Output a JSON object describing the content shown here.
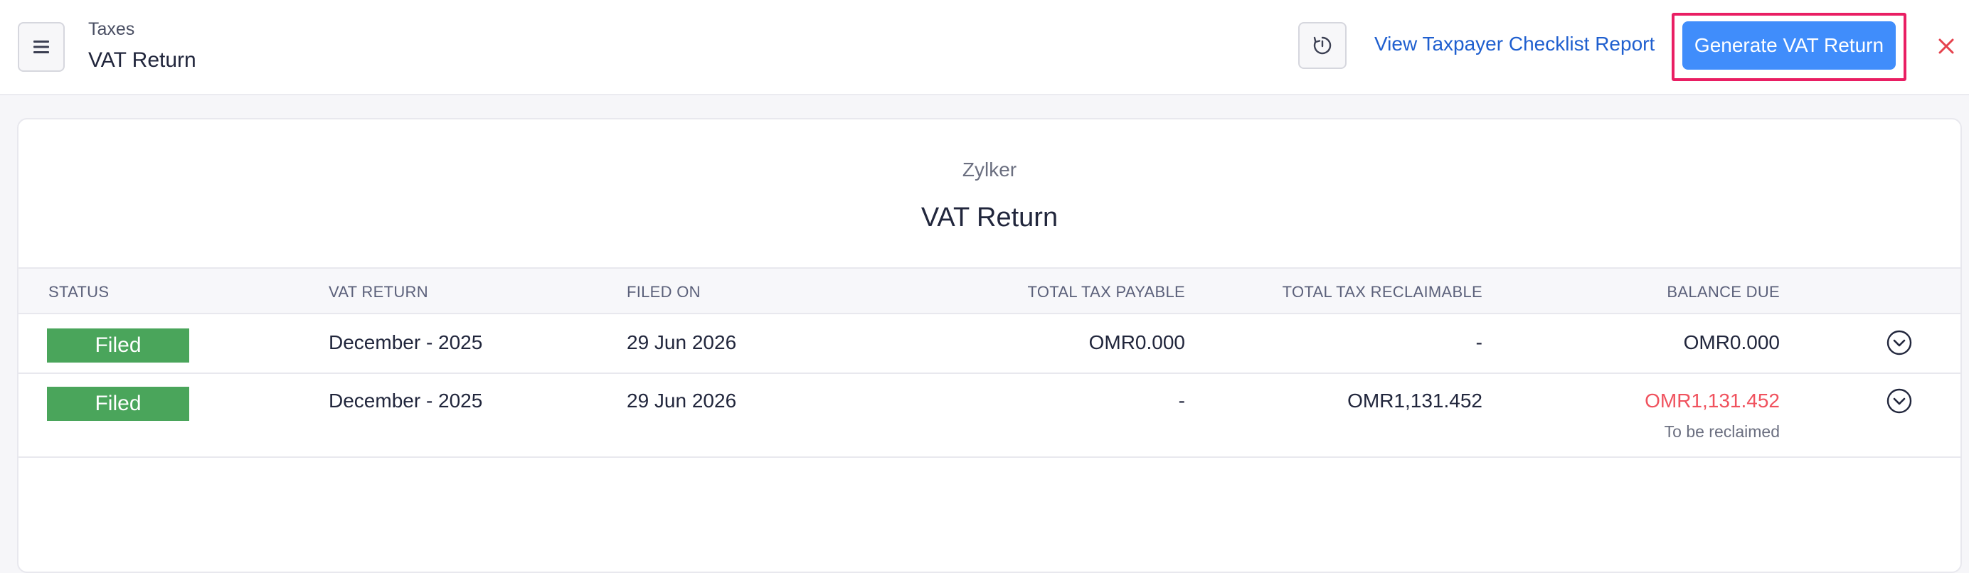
{
  "header": {
    "breadcrumb": "Taxes",
    "title": "VAT Return",
    "checklist_link": "View Taxpayer Checklist Report",
    "generate_button": "Generate VAT Return"
  },
  "report": {
    "organization": "Zylker",
    "title": "VAT Return",
    "columns": {
      "status": "STATUS",
      "vat_return": "VAT RETURN",
      "filed_on": "FILED ON",
      "total_tax_payable": "TOTAL TAX PAYABLE",
      "total_tax_reclaimable": "TOTAL TAX RECLAIMABLE",
      "balance_due": "BALANCE DUE"
    },
    "rows": [
      {
        "status": "Filed",
        "vat_return": "December - 2025",
        "filed_on": "29 Jun 2026",
        "total_tax_payable": "OMR0.000",
        "total_tax_reclaimable": "-",
        "balance_due": "OMR0.000",
        "balance_note": ""
      },
      {
        "status": "Filed",
        "vat_return": "December - 2025",
        "filed_on": "29 Jun 2026",
        "total_tax_payable": "-",
        "total_tax_reclaimable": "OMR1,131.452",
        "balance_due": "OMR1,131.452",
        "balance_note": "To be reclaimed"
      }
    ]
  },
  "colors": {
    "accent": "#408dfb",
    "link": "#1f5fcf",
    "status_filed": "#4aa55b",
    "highlight": "#e91e63",
    "negative_balance": "#f0525e"
  },
  "icons": {
    "menu": "hamburger-icon",
    "refresh": "refresh-icon",
    "close": "close-icon",
    "expand": "chevron-down-circle-icon"
  }
}
